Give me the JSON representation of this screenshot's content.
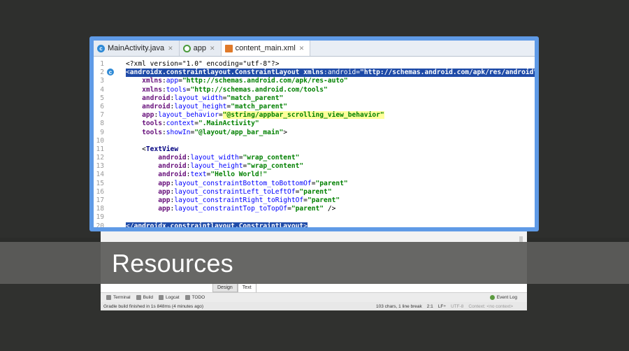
{
  "banner": {
    "title": "Resources"
  },
  "editor": {
    "tabs": [
      {
        "label": "MainActivity.java",
        "icon": "c-class-icon",
        "active": false
      },
      {
        "label": "app",
        "icon": "app-module-icon",
        "active": false
      },
      {
        "label": "content_main.xml",
        "icon": "xml-file-icon",
        "active": true
      }
    ],
    "lines": [
      {
        "n": "1",
        "text": "<?xml version=\"1.0\" encoding=\"utf-8\"?>"
      },
      {
        "n": "2",
        "text": "<androidx.constraintlayout.ConstraintLayout xmlns:android=\"http://schemas.android.com/apk/res/android\""
      },
      {
        "n": "3",
        "text": "    xmlns:app=\"http://schemas.android.com/apk/res-auto\""
      },
      {
        "n": "4",
        "text": "    xmlns:tools=\"http://schemas.android.com/tools\""
      },
      {
        "n": "5",
        "text": "    android:layout_width=\"match_parent\""
      },
      {
        "n": "6",
        "text": "    android:layout_height=\"match_parent\""
      },
      {
        "n": "7",
        "text": "    app:layout_behavior=\"@string/appbar_scrolling_view_behavior\""
      },
      {
        "n": "8",
        "text": "    tools:context=\".MainActivity\""
      },
      {
        "n": "9",
        "text": "    tools:showIn=\"@layout/app_bar_main\">"
      },
      {
        "n": "10",
        "text": ""
      },
      {
        "n": "11",
        "text": "    <TextView"
      },
      {
        "n": "12",
        "text": "        android:layout_width=\"wrap_content\""
      },
      {
        "n": "13",
        "text": "        android:layout_height=\"wrap_content\""
      },
      {
        "n": "14",
        "text": "        android:text=\"Hello World!\""
      },
      {
        "n": "15",
        "text": "        app:layout_constraintBottom_toBottomOf=\"parent\""
      },
      {
        "n": "16",
        "text": "        app:layout_constraintLeft_toLeftOf=\"parent\""
      },
      {
        "n": "17",
        "text": "        app:layout_constraintRight_toRightOf=\"parent\""
      },
      {
        "n": "18",
        "text": "        app:layout_constraintTop_toTopOf=\"parent\" />"
      },
      {
        "n": "19",
        "text": ""
      },
      {
        "n": "20",
        "text": "</androidx.constraintlayout.ConstraintLayout>"
      }
    ]
  },
  "ide": {
    "design_tabs": [
      "Design",
      "Text"
    ],
    "toolbar": [
      "Terminal",
      "Build",
      "Logcat",
      "TODO"
    ],
    "event_log": "Event Log",
    "status_left": "Gradle build finished in 1s 848ms (4 minutes ago)",
    "status_right": [
      "103 chars, 1 line break",
      "2:1",
      "LF÷",
      "UTF-8",
      "Context: <no context>"
    ]
  },
  "colors": {
    "accent": "#5f9ae6",
    "selection": "#1f4ba8",
    "banner": "#5c5d5a"
  }
}
